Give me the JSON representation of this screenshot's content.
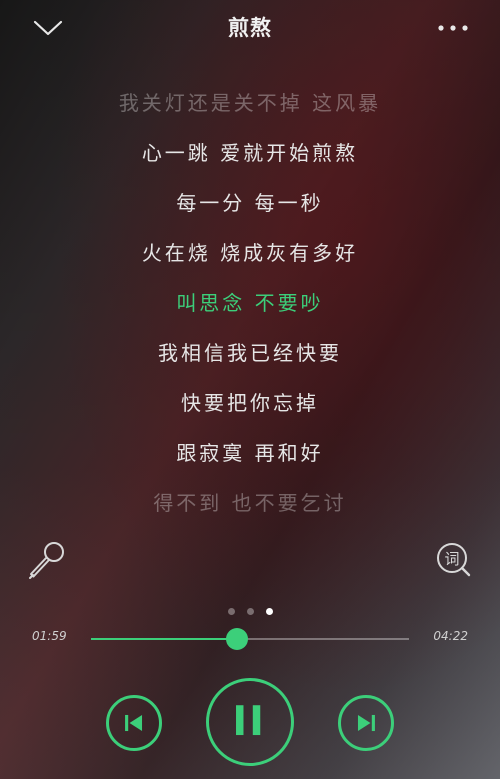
{
  "header": {
    "title": "煎熬",
    "back_icon": "chevron-down-icon",
    "more_icon": "more-horizontal-icon"
  },
  "lyrics": [
    {
      "text": "我关灯还是关不掉 这风暴",
      "state": "faint"
    },
    {
      "text": "心一跳 爱就开始煎熬",
      "state": "normal"
    },
    {
      "text": "每一分 每一秒",
      "state": "normal"
    },
    {
      "text": "火在烧 烧成灰有多好",
      "state": "normal"
    },
    {
      "text": "叫思念 不要吵",
      "state": "current"
    },
    {
      "text": "我相信我已经快要",
      "state": "normal"
    },
    {
      "text": "快要把你忘掉",
      "state": "normal"
    },
    {
      "text": "跟寂寞 再和好",
      "state": "normal"
    },
    {
      "text": "得不到 也不要乞讨",
      "state": "faint"
    }
  ],
  "tools": {
    "mic_icon": "microphone-icon",
    "lyric_search_icon": "lyric-search-icon",
    "lyric_search_glyph": "词"
  },
  "pager": {
    "count": 3,
    "active_index": 2
  },
  "playback": {
    "current_time": "01:59",
    "total_time": "04:22",
    "progress": 0.46
  },
  "controls": {
    "prev_icon": "skip-previous-icon",
    "pause_icon": "pause-icon",
    "next_icon": "skip-next-icon"
  },
  "colors": {
    "accent": "#3ccf7a",
    "text": "#e6e6e6",
    "faint_text": "rgba(235,235,235,0.35)"
  }
}
